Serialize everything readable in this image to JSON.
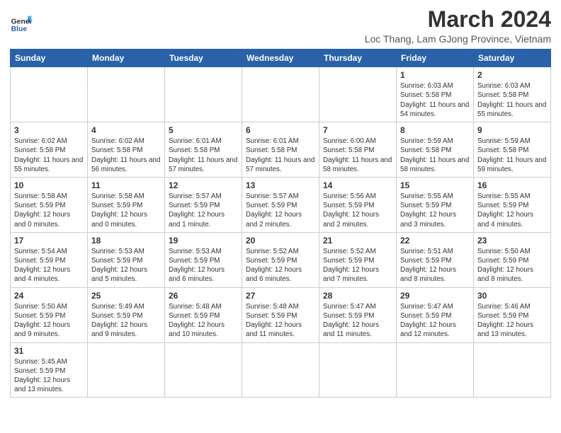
{
  "header": {
    "logo_general": "General",
    "logo_blue": "Blue",
    "month_year": "March 2024",
    "location": "Loc Thang, Lam GJong Province, Vietnam"
  },
  "weekdays": [
    "Sunday",
    "Monday",
    "Tuesday",
    "Wednesday",
    "Thursday",
    "Friday",
    "Saturday"
  ],
  "weeks": [
    [
      {
        "day": "",
        "info": ""
      },
      {
        "day": "",
        "info": ""
      },
      {
        "day": "",
        "info": ""
      },
      {
        "day": "",
        "info": ""
      },
      {
        "day": "",
        "info": ""
      },
      {
        "day": "1",
        "info": "Sunrise: 6:03 AM\nSunset: 5:58 PM\nDaylight: 11 hours\nand 54 minutes."
      },
      {
        "day": "2",
        "info": "Sunrise: 6:03 AM\nSunset: 5:58 PM\nDaylight: 11 hours\nand 55 minutes."
      }
    ],
    [
      {
        "day": "3",
        "info": "Sunrise: 6:02 AM\nSunset: 5:58 PM\nDaylight: 11 hours\nand 55 minutes."
      },
      {
        "day": "4",
        "info": "Sunrise: 6:02 AM\nSunset: 5:58 PM\nDaylight: 11 hours\nand 56 minutes."
      },
      {
        "day": "5",
        "info": "Sunrise: 6:01 AM\nSunset: 5:58 PM\nDaylight: 11 hours\nand 57 minutes."
      },
      {
        "day": "6",
        "info": "Sunrise: 6:01 AM\nSunset: 5:58 PM\nDaylight: 11 hours\nand 57 minutes."
      },
      {
        "day": "7",
        "info": "Sunrise: 6:00 AM\nSunset: 5:58 PM\nDaylight: 11 hours\nand 58 minutes."
      },
      {
        "day": "8",
        "info": "Sunrise: 5:59 AM\nSunset: 5:58 PM\nDaylight: 11 hours\nand 58 minutes."
      },
      {
        "day": "9",
        "info": "Sunrise: 5:59 AM\nSunset: 5:58 PM\nDaylight: 11 hours\nand 59 minutes."
      }
    ],
    [
      {
        "day": "10",
        "info": "Sunrise: 5:58 AM\nSunset: 5:59 PM\nDaylight: 12 hours\nand 0 minutes."
      },
      {
        "day": "11",
        "info": "Sunrise: 5:58 AM\nSunset: 5:59 PM\nDaylight: 12 hours\nand 0 minutes."
      },
      {
        "day": "12",
        "info": "Sunrise: 5:57 AM\nSunset: 5:59 PM\nDaylight: 12 hours\nand 1 minute."
      },
      {
        "day": "13",
        "info": "Sunrise: 5:57 AM\nSunset: 5:59 PM\nDaylight: 12 hours\nand 2 minutes."
      },
      {
        "day": "14",
        "info": "Sunrise: 5:56 AM\nSunset: 5:59 PM\nDaylight: 12 hours\nand 2 minutes."
      },
      {
        "day": "15",
        "info": "Sunrise: 5:55 AM\nSunset: 5:59 PM\nDaylight: 12 hours\nand 3 minutes."
      },
      {
        "day": "16",
        "info": "Sunrise: 5:55 AM\nSunset: 5:59 PM\nDaylight: 12 hours\nand 4 minutes."
      }
    ],
    [
      {
        "day": "17",
        "info": "Sunrise: 5:54 AM\nSunset: 5:59 PM\nDaylight: 12 hours\nand 4 minutes."
      },
      {
        "day": "18",
        "info": "Sunrise: 5:53 AM\nSunset: 5:59 PM\nDaylight: 12 hours\nand 5 minutes."
      },
      {
        "day": "19",
        "info": "Sunrise: 5:53 AM\nSunset: 5:59 PM\nDaylight: 12 hours\nand 6 minutes."
      },
      {
        "day": "20",
        "info": "Sunrise: 5:52 AM\nSunset: 5:59 PM\nDaylight: 12 hours\nand 6 minutes."
      },
      {
        "day": "21",
        "info": "Sunrise: 5:52 AM\nSunset: 5:59 PM\nDaylight: 12 hours\nand 7 minutes."
      },
      {
        "day": "22",
        "info": "Sunrise: 5:51 AM\nSunset: 5:59 PM\nDaylight: 12 hours\nand 8 minutes."
      },
      {
        "day": "23",
        "info": "Sunrise: 5:50 AM\nSunset: 5:59 PM\nDaylight: 12 hours\nand 8 minutes."
      }
    ],
    [
      {
        "day": "24",
        "info": "Sunrise: 5:50 AM\nSunset: 5:59 PM\nDaylight: 12 hours\nand 9 minutes."
      },
      {
        "day": "25",
        "info": "Sunrise: 5:49 AM\nSunset: 5:59 PM\nDaylight: 12 hours\nand 9 minutes."
      },
      {
        "day": "26",
        "info": "Sunrise: 5:48 AM\nSunset: 5:59 PM\nDaylight: 12 hours\nand 10 minutes."
      },
      {
        "day": "27",
        "info": "Sunrise: 5:48 AM\nSunset: 5:59 PM\nDaylight: 12 hours\nand 11 minutes."
      },
      {
        "day": "28",
        "info": "Sunrise: 5:47 AM\nSunset: 5:59 PM\nDaylight: 12 hours\nand 11 minutes."
      },
      {
        "day": "29",
        "info": "Sunrise: 5:47 AM\nSunset: 5:59 PM\nDaylight: 12 hours\nand 12 minutes."
      },
      {
        "day": "30",
        "info": "Sunrise: 5:46 AM\nSunset: 5:59 PM\nDaylight: 12 hours\nand 13 minutes."
      }
    ],
    [
      {
        "day": "31",
        "info": "Sunrise: 5:45 AM\nSunset: 5:59 PM\nDaylight: 12 hours\nand 13 minutes."
      },
      {
        "day": "",
        "info": ""
      },
      {
        "day": "",
        "info": ""
      },
      {
        "day": "",
        "info": ""
      },
      {
        "day": "",
        "info": ""
      },
      {
        "day": "",
        "info": ""
      },
      {
        "day": "",
        "info": ""
      }
    ]
  ]
}
